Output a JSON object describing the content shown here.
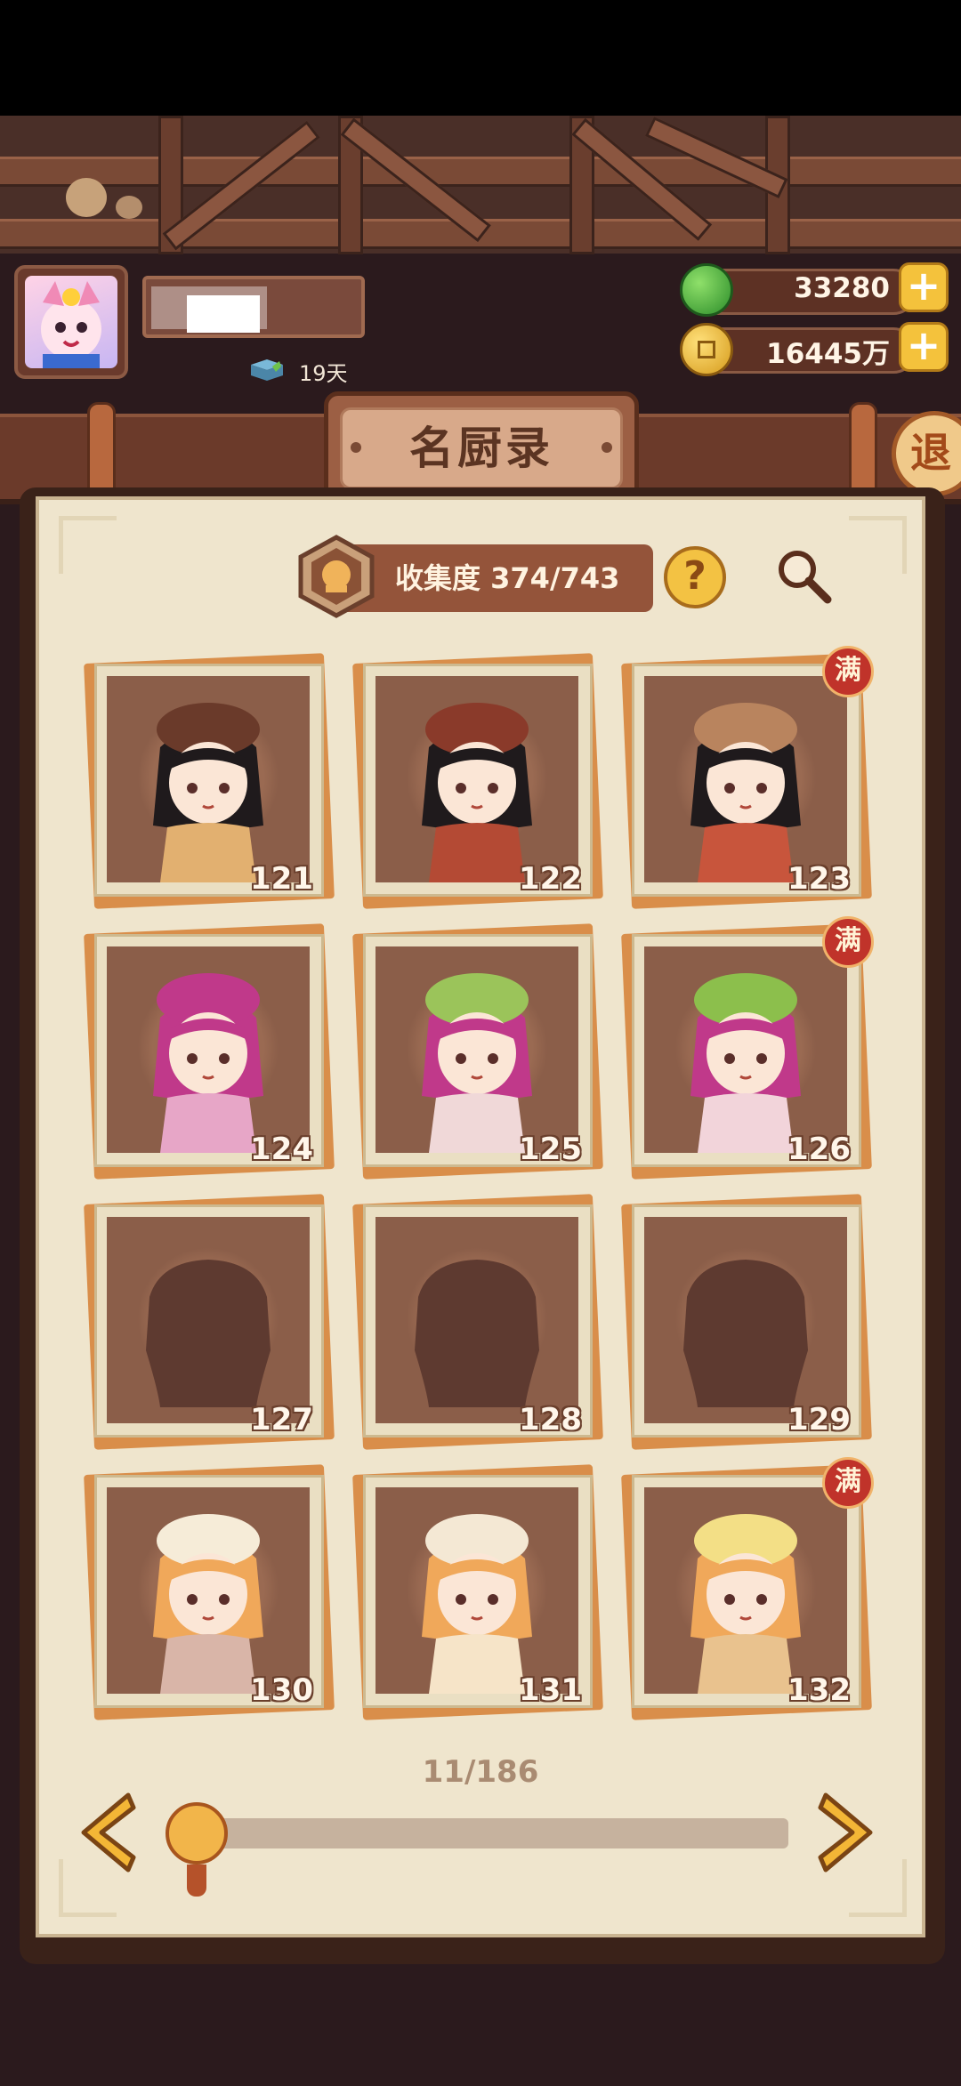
{
  "profile": {
    "days_label": "19天"
  },
  "currency": {
    "jade": "33280",
    "coins": "16445万",
    "plus_label": "+"
  },
  "header": {
    "title": "名厨录",
    "exit_label": "退"
  },
  "collection": {
    "label": "收集度 374/743",
    "help_label": "?"
  },
  "cards": [
    {
      "num": "121",
      "full": false,
      "state": "unlocked",
      "hair": "#1f1a1c",
      "hat": "#6a3a2a",
      "robe": "#e2b070"
    },
    {
      "num": "122",
      "full": false,
      "state": "unlocked",
      "hair": "#1f1a1c",
      "hat": "#8a3a2a",
      "robe": "#b44a34"
    },
    {
      "num": "123",
      "full": true,
      "state": "unlocked",
      "hair": "#1f1a1c",
      "hat": "#b9845e",
      "robe": "#c8553c"
    },
    {
      "num": "124",
      "full": false,
      "state": "unlocked",
      "hair": "#c0398a",
      "hat": "#c0398a",
      "robe": "#e7a6c7"
    },
    {
      "num": "125",
      "full": false,
      "state": "unlocked",
      "hair": "#c0398a",
      "hat": "#9bc45a",
      "robe": "#f0d8d8"
    },
    {
      "num": "126",
      "full": true,
      "state": "unlocked",
      "hair": "#c0398a",
      "hat": "#8cbf4c",
      "robe": "#f2d4da"
    },
    {
      "num": "127",
      "full": false,
      "state": "locked"
    },
    {
      "num": "128",
      "full": false,
      "state": "locked"
    },
    {
      "num": "129",
      "full": false,
      "state": "locked"
    },
    {
      "num": "130",
      "full": false,
      "state": "unlocked",
      "hair": "#f0a85a",
      "hat": "#f6ecd8",
      "robe": "#d9b5a8"
    },
    {
      "num": "131",
      "full": false,
      "state": "unlocked",
      "hair": "#f0a85a",
      "hat": "#f4e8d4",
      "robe": "#f6e4c8"
    },
    {
      "num": "132",
      "full": true,
      "state": "unlocked",
      "hair": "#f0a85a",
      "hat": "#f3df86",
      "robe": "#e9c28e"
    }
  ],
  "full_badge": "满",
  "pagination": {
    "label": "11/186",
    "current": 11,
    "total": 186
  },
  "colors": {
    "card_bg": "#8b5e49",
    "panel": "#efe5cd",
    "accent": "#f4c23c",
    "full_badge": "#c0332a"
  }
}
